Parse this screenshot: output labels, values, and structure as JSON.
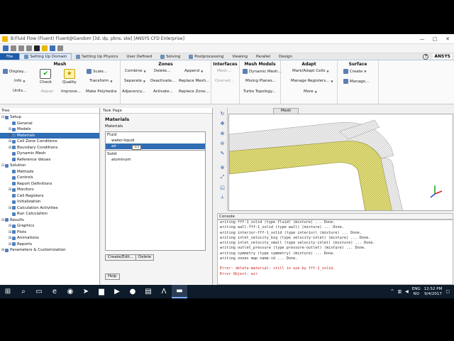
{
  "window": {
    "title": "B:Fluid Flow (Fluent) Fluent@Gandom [3d, dp, pbns, ske] [ANSYS CFD Enterprise]",
    "buttons": [
      "—",
      "□",
      "✕"
    ]
  },
  "tabs": [
    {
      "label": "File"
    },
    {
      "label": "Setting Up Domain"
    },
    {
      "label": "Setting Up Physics"
    },
    {
      "label": "User Defined"
    },
    {
      "label": "Solving"
    },
    {
      "label": "Postprocessing"
    },
    {
      "label": "Viewing"
    },
    {
      "label": "Parallel"
    },
    {
      "label": "Design"
    }
  ],
  "brand": "ANSYS",
  "help_glyph": "?",
  "ribbon": {
    "mesh": {
      "title": "Mesh",
      "display": "Display...",
      "info": "Info",
      "units": "Units...",
      "check": "Check",
      "quality": "Quality",
      "repair": "Repair",
      "improve": "Improve...",
      "scale": "Scale...",
      "transform": "Transform",
      "make_polyhedra": "Make Polyhedra"
    },
    "zones": {
      "title": "Zones",
      "combine": "Combine",
      "separate": "Separate",
      "adjacency": "Adjacency...",
      "delete": "Delete...",
      "deactivate": "Deactivate...",
      "activate": "Activate...",
      "append": "Append",
      "replace_mesh": "Replace Mesh...",
      "replace_zone": "Replace Zone..."
    },
    "interfaces": {
      "title": "Interfaces",
      "mesh": "Mesh...",
      "overset": "Overset..."
    },
    "mesh_models": {
      "title": "Mesh Models",
      "dynamic_mesh": "Dynamic Mesh...",
      "mixing_planes": "Mixing Planes...",
      "turbo_topology": "Turbo Topology..."
    },
    "adapt": {
      "title": "Adapt",
      "mark_adapt": "Mark/Adapt Cells",
      "manage_registers": "Manage Registers...",
      "more": "More"
    },
    "surface": {
      "title": "Surface",
      "create": "Create",
      "manage": "Manage..."
    }
  },
  "tree": {
    "title": "Tree",
    "items": [
      {
        "label": "Setup",
        "level": 0,
        "expander": "⊟"
      },
      {
        "label": "General",
        "level": 1
      },
      {
        "label": "Models",
        "level": 1,
        "expander": "⊞"
      },
      {
        "label": "Materials",
        "level": 1,
        "expander": "⊞",
        "selected": true
      },
      {
        "label": "Cell Zone Conditions",
        "level": 1,
        "expander": "⊞"
      },
      {
        "label": "Boundary Conditions",
        "level": 1,
        "expander": "⊞"
      },
      {
        "label": "Dynamic Mesh",
        "level": 1
      },
      {
        "label": "Reference Values",
        "level": 1
      },
      {
        "label": "Solution",
        "level": 0,
        "expander": "⊟"
      },
      {
        "label": "Methods",
        "level": 1
      },
      {
        "label": "Controls",
        "level": 1
      },
      {
        "label": "Report Definitions",
        "level": 1
      },
      {
        "label": "Monitors",
        "level": 1,
        "expander": "⊞"
      },
      {
        "label": "Cell Registers",
        "level": 1
      },
      {
        "label": "Initialization",
        "level": 1
      },
      {
        "label": "Calculation Activities",
        "level": 1,
        "expander": "⊞"
      },
      {
        "label": "Run Calculation",
        "level": 1
      },
      {
        "label": "Results",
        "level": 0,
        "expander": "⊟"
      },
      {
        "label": "Graphics",
        "level": 1,
        "expander": "⊞"
      },
      {
        "label": "Plots",
        "level": 1,
        "expander": "⊞"
      },
      {
        "label": "Animations",
        "level": 1,
        "expander": "⊞"
      },
      {
        "label": "Reports",
        "level": 1,
        "expander": "⊞"
      },
      {
        "label": "Parameters & Customization",
        "level": 0,
        "expander": "⊞"
      }
    ]
  },
  "task_page": {
    "title": "Task Page",
    "heading": "Materials",
    "sublabel": "Materials",
    "tooltip": "1/3",
    "list": [
      {
        "label": "Fluid",
        "type": "cat"
      },
      {
        "label": "water-liquid",
        "type": "it"
      },
      {
        "label": "air",
        "type": "it",
        "selected": true
      },
      {
        "label": "Solid",
        "type": "cat"
      },
      {
        "label": "aluminum",
        "type": "it"
      }
    ],
    "buttons": {
      "create_edit": "Create/Edit...",
      "delete": "Delete",
      "help": "Help"
    }
  },
  "graphics": {
    "tab": "Mesh",
    "mesh_color": "#e4e07a",
    "toolbar_icons": [
      "rotate-icon",
      "pan-icon",
      "zoom-in-icon",
      "zoom-out-icon",
      "probe-icon",
      "zoom-box-icon",
      "fit-icon",
      "view-icon",
      "axes-icon"
    ]
  },
  "console": {
    "title": "Console",
    "lines": [
      {
        "text": "writing fff-1_solid (type fluid) (mixture) ... Done.",
        "err": false
      },
      {
        "text": "writing wall-fff-1_solid (type wall) (mixture) ... Done.",
        "err": false
      },
      {
        "text": "writing interior-fff-1_solid (type interior) (mixture) ... Done.",
        "err": false
      },
      {
        "text": "writing inlet_velocity_big (type velocity-inlet) (mixture) ... Done.",
        "err": false
      },
      {
        "text": "writing inlet_velocity_small (type velocity-inlet) (mixture) ... Done.",
        "err": false
      },
      {
        "text": "writing outlet_pressure (type pressure-outlet) (mixture) ... Done.",
        "err": false
      },
      {
        "text": "writing symmetry (type symmetry) (mixture) ... Done.",
        "err": false
      },
      {
        "text": "writing zones map name-id ... Done.",
        "err": false
      },
      {
        "text": "",
        "err": false
      },
      {
        "text": "Error: delete-material: still in use by fff-1_solid.",
        "err": true
      },
      {
        "text": "Error Object: air",
        "err": true
      }
    ]
  },
  "taskbar": {
    "lang": [
      "ENG",
      "NO"
    ],
    "time": "12:52 PM",
    "date": "9/4/2017"
  }
}
